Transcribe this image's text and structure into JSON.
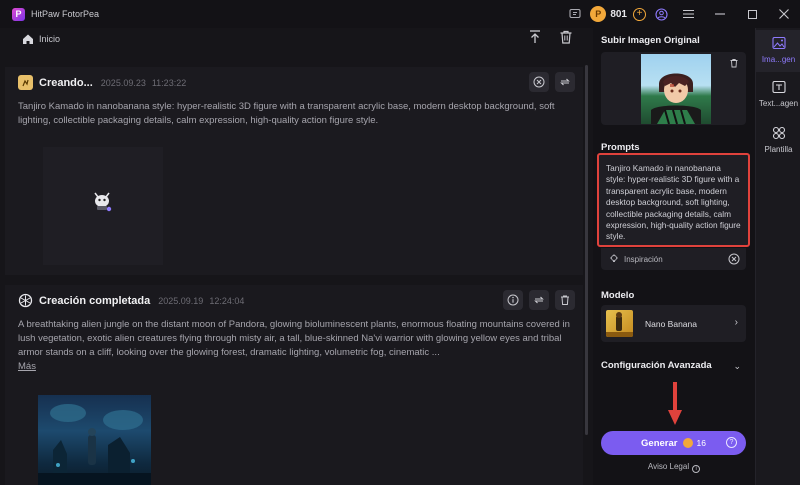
{
  "app": {
    "title": "HitPaw FotorPea",
    "logo_letter": "P"
  },
  "titlebar": {
    "coin_count": "801",
    "coin_symbol": "P",
    "plus": "+"
  },
  "toolbar": {
    "home_label": "Inicio"
  },
  "feed": {
    "cards": [
      {
        "title": "Creando...",
        "date": "2025.09.23",
        "time": "11:23:22",
        "text": "Tanjiro Kamado in nanobanana style: hyper-realistic 3D figure with a transparent acrylic base, modern desktop background, soft lighting, collectible packaging details, calm expression, high-quality action figure style."
      },
      {
        "title": "Creación completada",
        "date": "2025.09.19",
        "time": "12:24:04",
        "text": "A breathtaking alien jungle on the distant moon of Pandora, glowing bioluminescent plants, enormous floating mountains covered in lush vegetation, exotic alien creatures flying through misty air, a tall, blue-skinned Na'vi warrior with glowing yellow eyes and tribal armor stands on a cliff, looking over the glowing forest, dramatic lighting, volumetric fog, cinematic ...",
        "more": "Más"
      }
    ]
  },
  "panel": {
    "upload_title": "Subir Imagen Original",
    "prompts_title": "Prompts",
    "prompt_text": "Tanjiro Kamado in nanobanana style: hyper-realistic 3D figure with a transparent acrylic base, modern desktop background, soft lighting, collectible packaging details, calm expression, high-quality action figure style.",
    "inspiration_label": "Inspiración",
    "model_title": "Modelo",
    "model_name": "Nano Banana",
    "advanced_title": "Configuración Avanzada",
    "generate_label": "Generar",
    "generate_cost": "16",
    "help": "?",
    "legal_label": "Aviso Legal",
    "legal_info": "i"
  },
  "rail": {
    "items": [
      {
        "label": "Imagen",
        "icon": "image-icon"
      },
      {
        "label": "Texto a Imagen",
        "icon": "text-image-icon"
      },
      {
        "label": "Plantilla",
        "icon": "template-icon"
      }
    ],
    "visible_labels": [
      "Ima...gen",
      "Text...agen",
      "Plantilla"
    ]
  },
  "colors": {
    "accent": "#7b5cf0",
    "highlight": "#e0423c",
    "coin": "#f2a83a",
    "background": "#161519"
  }
}
